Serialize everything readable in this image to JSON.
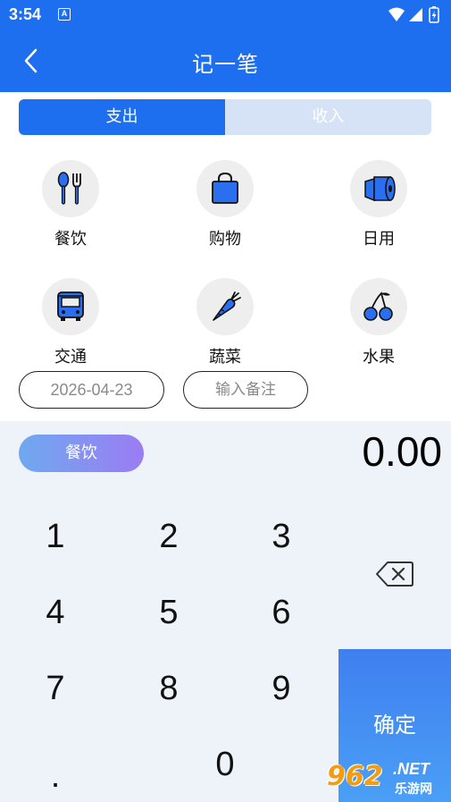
{
  "status_bar": {
    "time": "3:54",
    "notification_icon": "A"
  },
  "header": {
    "title": "记一笔"
  },
  "tabs": [
    {
      "label": "支出",
      "active": true
    },
    {
      "label": "收入",
      "active": false
    }
  ],
  "categories": [
    {
      "label": "餐饮",
      "icon": "utensils-icon"
    },
    {
      "label": "购物",
      "icon": "shopping-bag-icon"
    },
    {
      "label": "日用",
      "icon": "toilet-paper-icon"
    },
    {
      "label": "交通",
      "icon": "bus-icon"
    },
    {
      "label": "蔬菜",
      "icon": "carrot-icon"
    },
    {
      "label": "水果",
      "icon": "cherry-icon"
    }
  ],
  "date": {
    "value": "2026-04-23"
  },
  "note": {
    "placeholder": "输入备注"
  },
  "selected_category": "餐饮",
  "amount": "0.00",
  "keypad": {
    "keys": [
      "1",
      "2",
      "3",
      "4",
      "5",
      "6",
      "7",
      "8",
      "9",
      ".",
      "0"
    ],
    "confirm_label": "确定"
  },
  "watermark": {
    "logo": "962",
    "net": ".NET",
    "site": "乐游网"
  },
  "colors": {
    "primary": "#1e6ff0",
    "tab_inactive": "#d6e3f6",
    "keypad_bg": "#eef2f9",
    "icon_circle": "#eeeeee"
  }
}
